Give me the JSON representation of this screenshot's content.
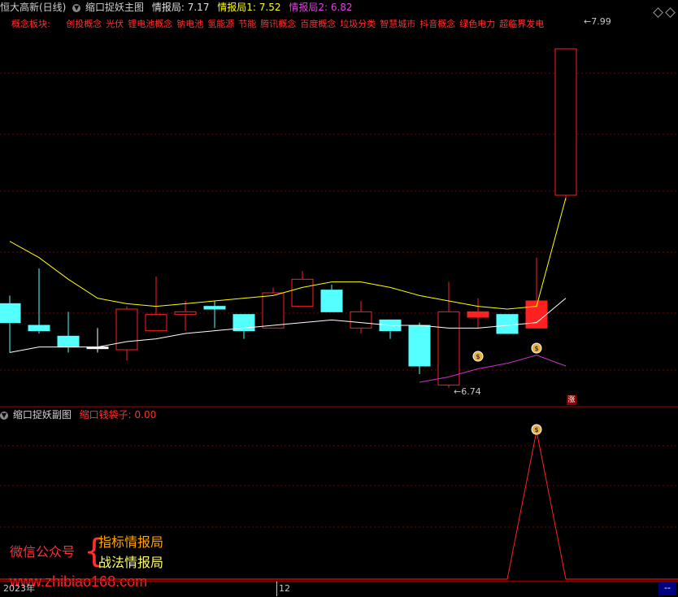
{
  "header": {
    "stock_label": "恒大高新(日线)",
    "main_title": "缩口捉妖主图",
    "ind0_label": "情报局: ",
    "ind0_value": "7.17",
    "ind1_label": "情报局1: ",
    "ind1_value": "7.52",
    "ind2_label": "情报局2: ",
    "ind2_value": "6.82",
    "icon_left": "chevron-down-icon",
    "icon_right": "diamond-icon"
  },
  "concepts": {
    "label": "概念板块:",
    "items": [
      "创投概念",
      "光伏",
      "锂电池概念",
      "钠电池",
      "氢能源",
      "节能",
      "腾讯概念",
      "百度概念",
      "垃圾分类",
      "智慧城市",
      "抖音概念",
      "绿色电力",
      "超临界发电"
    ]
  },
  "sub_panel": {
    "title": "缩口捉妖副图",
    "indicator_label": "缩口钱袋子: ",
    "indicator_value": "0.00"
  },
  "watermark": {
    "wechat": "微信公众号",
    "line1": "指标情报局",
    "line2": "战法情报局",
    "url": "www.zhibiao168.com"
  },
  "axis": {
    "year": "2023年",
    "month": "12",
    "corner": "--"
  },
  "colors": {
    "up": "#ff2020",
    "down": "#54ffff",
    "ma_white": "#ffffff",
    "ma_yellow": "#ffff00",
    "ma_magenta": "#d030d0",
    "sub_line": "#ff2020",
    "grid": "#7a0000"
  },
  "chart_data": [
    {
      "type": "candlestick",
      "title": "缩口捉妖主图",
      "high_label": "7.99",
      "low_label": "6.74",
      "limit_up_marker": "涨",
      "signal_icon": "money-bag-icon",
      "ylim": [
        6.7,
        8.05
      ],
      "candles": [
        {
          "open": 7.05,
          "close": 6.98,
          "high": 7.08,
          "low": 6.87,
          "dir": "down"
        },
        {
          "open": 6.97,
          "close": 6.95,
          "high": 7.18,
          "low": 6.94,
          "dir": "down"
        },
        {
          "open": 6.93,
          "close": 6.89,
          "high": 7.02,
          "low": 6.87,
          "dir": "down"
        },
        {
          "open": 6.89,
          "close": 6.89,
          "high": 6.96,
          "low": 6.87,
          "dir": "flat"
        },
        {
          "open": 6.88,
          "close": 7.03,
          "high": 7.04,
          "low": 6.84,
          "dir": "up"
        },
        {
          "open": 6.95,
          "close": 7.01,
          "high": 7.15,
          "low": 6.95,
          "dir": "up"
        },
        {
          "open": 7.01,
          "close": 7.02,
          "high": 7.06,
          "low": 6.95,
          "dir": "up"
        },
        {
          "open": 7.03,
          "close": 7.04,
          "high": 7.06,
          "low": 6.96,
          "dir": "down"
        },
        {
          "open": 7.01,
          "close": 6.95,
          "high": 7.01,
          "low": 6.92,
          "dir": "down"
        },
        {
          "open": 6.96,
          "close": 7.09,
          "high": 7.11,
          "low": 6.96,
          "dir": "up"
        },
        {
          "open": 7.04,
          "close": 7.14,
          "high": 7.17,
          "low": 7.04,
          "dir": "up"
        },
        {
          "open": 7.1,
          "close": 7.02,
          "high": 7.12,
          "low": 7.02,
          "dir": "down"
        },
        {
          "open": 6.96,
          "close": 7.02,
          "high": 7.06,
          "low": 6.94,
          "dir": "up"
        },
        {
          "open": 6.99,
          "close": 6.95,
          "high": 6.99,
          "low": 6.92,
          "dir": "down"
        },
        {
          "open": 6.97,
          "close": 6.82,
          "high": 6.98,
          "low": 6.79,
          "dir": "down"
        },
        {
          "open": 6.75,
          "close": 7.02,
          "high": 7.13,
          "low": 6.74,
          "dir": "up"
        },
        {
          "open": 7.02,
          "close": 7.0,
          "high": 7.07,
          "low": 6.96,
          "dir": "flat_red"
        },
        {
          "open": 7.01,
          "close": 6.94,
          "high": 7.01,
          "low": 6.94,
          "dir": "down"
        },
        {
          "open": 6.96,
          "close": 7.06,
          "high": 7.22,
          "low": 6.96,
          "dir": "up_filled"
        },
        {
          "open": 7.45,
          "close": 7.99,
          "high": 7.99,
          "low": 7.43,
          "dir": "up"
        }
      ],
      "lines": [
        {
          "name": "情报局1",
          "color": "yellow",
          "values": [
            7.28,
            7.22,
            7.14,
            7.07,
            7.05,
            7.04,
            7.05,
            7.06,
            7.07,
            7.08,
            7.11,
            7.13,
            7.13,
            7.11,
            7.08,
            7.06,
            7.04,
            7.03,
            7.04,
            7.44
          ]
        },
        {
          "name": "情报局",
          "color": "white",
          "values": [
            6.87,
            6.89,
            6.89,
            6.89,
            6.91,
            6.92,
            6.94,
            6.95,
            6.96,
            6.97,
            6.98,
            6.99,
            6.98,
            6.97,
            6.97,
            6.96,
            6.96,
            6.97,
            6.98,
            7.07
          ]
        },
        {
          "name": "情报局2",
          "color": "magenta",
          "values": [
            null,
            null,
            null,
            null,
            null,
            null,
            null,
            null,
            null,
            null,
            null,
            null,
            null,
            null,
            6.76,
            6.78,
            6.81,
            6.83,
            6.86,
            6.82
          ]
        }
      ]
    },
    {
      "type": "line",
      "title": "缩口捉妖副图",
      "series": [
        {
          "name": "缩口钱袋子",
          "values": [
            0,
            0,
            0,
            0,
            0,
            0,
            0,
            0,
            0,
            0,
            0,
            0,
            0,
            0,
            0,
            0,
            0,
            0,
            1,
            0
          ]
        }
      ],
      "ylim": [
        0,
        1
      ]
    }
  ]
}
